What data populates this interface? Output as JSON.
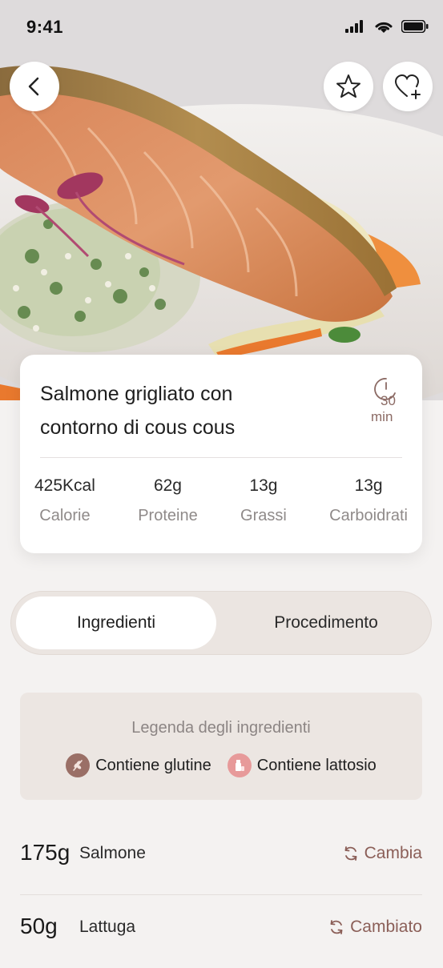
{
  "status_bar": {
    "time": "9:41"
  },
  "recipe": {
    "title_line1": "Salmone grigliato con",
    "title_line2": "contorno di cous cous",
    "time_value": "30",
    "time_unit": "min",
    "nutrients": [
      {
        "value": "425Kcal",
        "label": "Calorie"
      },
      {
        "value": "62g",
        "label": "Proteine"
      },
      {
        "value": "13g",
        "label": "Grassi"
      },
      {
        "value": "13g",
        "label": "Carboidrati"
      }
    ]
  },
  "tabs": {
    "active": "Ingredienti",
    "inactive": "Procedimento"
  },
  "legend": {
    "title": "Legenda degli ingredienti",
    "gluten": "Contiene glutine",
    "lactose": "Contiene lattosio",
    "gluten_color": "#9a6f66",
    "lactose_color": "#e79a9a"
  },
  "ingredients": [
    {
      "qty": "175g",
      "name": "Salmone",
      "action": "Cambia"
    },
    {
      "qty": "50g",
      "name": "Lattuga",
      "action": "Cambiato"
    }
  ],
  "colors": {
    "accent": "#8b5f58",
    "background": "#f4f2f1"
  },
  "icons": {
    "back": "chevron-left-icon",
    "favorite": "star-icon",
    "add_favorite": "heart-plus-icon",
    "timer": "timer-icon",
    "swap": "refresh-icon"
  }
}
